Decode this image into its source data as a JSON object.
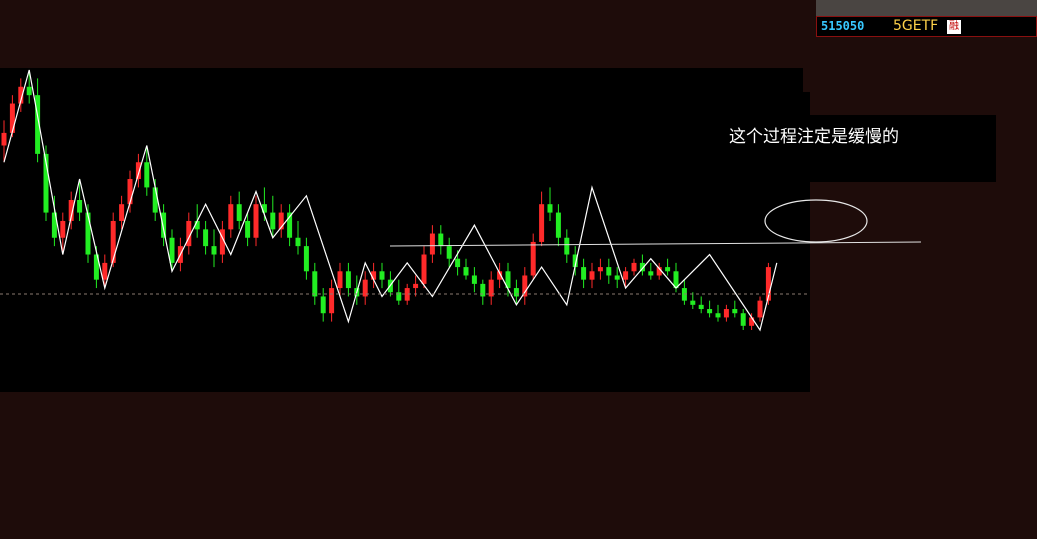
{
  "ticker": {
    "code": "515050",
    "name": "5GETF",
    "badge": "融"
  },
  "annotation": {
    "text": "这个过程注定是缓慢的"
  },
  "colors": {
    "background": "#1e0c0a",
    "plot_background": "#000000",
    "up": "#ff2a2a",
    "down": "#22ee22",
    "line": "#ffffff",
    "ticker_code": "#38c8ff",
    "ticker_name": "#ffd24a"
  },
  "chart_data": {
    "type": "candlestick",
    "title": "",
    "xlabel": "",
    "ylabel": "",
    "grid": false,
    "ylim": [
      0,
      100
    ],
    "reference_price": 41,
    "candles": [
      {
        "o": 74,
        "h": 80,
        "l": 70,
        "c": 77
      },
      {
        "o": 77,
        "h": 86,
        "l": 76,
        "c": 84
      },
      {
        "o": 84,
        "h": 90,
        "l": 82,
        "c": 88
      },
      {
        "o": 88,
        "h": 92,
        "l": 84,
        "c": 86
      },
      {
        "o": 86,
        "h": 90,
        "l": 70,
        "c": 72
      },
      {
        "o": 72,
        "h": 74,
        "l": 56,
        "c": 58
      },
      {
        "o": 58,
        "h": 62,
        "l": 50,
        "c": 52
      },
      {
        "o": 52,
        "h": 58,
        "l": 48,
        "c": 56
      },
      {
        "o": 56,
        "h": 63,
        "l": 54,
        "c": 61
      },
      {
        "o": 61,
        "h": 66,
        "l": 56,
        "c": 58
      },
      {
        "o": 58,
        "h": 60,
        "l": 46,
        "c": 48
      },
      {
        "o": 48,
        "h": 50,
        "l": 40,
        "c": 42
      },
      {
        "o": 42,
        "h": 48,
        "l": 40,
        "c": 46
      },
      {
        "o": 46,
        "h": 58,
        "l": 45,
        "c": 56
      },
      {
        "o": 56,
        "h": 62,
        "l": 54,
        "c": 60
      },
      {
        "o": 60,
        "h": 68,
        "l": 58,
        "c": 66
      },
      {
        "o": 66,
        "h": 72,
        "l": 64,
        "c": 70
      },
      {
        "o": 70,
        "h": 74,
        "l": 62,
        "c": 64
      },
      {
        "o": 64,
        "h": 66,
        "l": 56,
        "c": 58
      },
      {
        "o": 58,
        "h": 60,
        "l": 50,
        "c": 52
      },
      {
        "o": 52,
        "h": 54,
        "l": 44,
        "c": 46
      },
      {
        "o": 46,
        "h": 52,
        "l": 44,
        "c": 50
      },
      {
        "o": 50,
        "h": 58,
        "l": 48,
        "c": 56
      },
      {
        "o": 56,
        "h": 60,
        "l": 52,
        "c": 54
      },
      {
        "o": 54,
        "h": 56,
        "l": 48,
        "c": 50
      },
      {
        "o": 50,
        "h": 54,
        "l": 45,
        "c": 48
      },
      {
        "o": 48,
        "h": 56,
        "l": 46,
        "c": 54
      },
      {
        "o": 54,
        "h": 62,
        "l": 52,
        "c": 60
      },
      {
        "o": 60,
        "h": 63,
        "l": 54,
        "c": 56
      },
      {
        "o": 56,
        "h": 58,
        "l": 50,
        "c": 52
      },
      {
        "o": 52,
        "h": 62,
        "l": 50,
        "c": 60
      },
      {
        "o": 60,
        "h": 64,
        "l": 56,
        "c": 58
      },
      {
        "o": 58,
        "h": 62,
        "l": 52,
        "c": 54
      },
      {
        "o": 54,
        "h": 60,
        "l": 52,
        "c": 58
      },
      {
        "o": 58,
        "h": 60,
        "l": 50,
        "c": 52
      },
      {
        "o": 52,
        "h": 56,
        "l": 48,
        "c": 50
      },
      {
        "o": 50,
        "h": 52,
        "l": 42,
        "c": 44
      },
      {
        "o": 44,
        "h": 46,
        "l": 36,
        "c": 38
      },
      {
        "o": 38,
        "h": 40,
        "l": 32,
        "c": 34
      },
      {
        "o": 34,
        "h": 42,
        "l": 32,
        "c": 40
      },
      {
        "o": 40,
        "h": 46,
        "l": 38,
        "c": 44
      },
      {
        "o": 44,
        "h": 46,
        "l": 38,
        "c": 40
      },
      {
        "o": 40,
        "h": 43,
        "l": 36,
        "c": 38
      },
      {
        "o": 38,
        "h": 44,
        "l": 36,
        "c": 42
      },
      {
        "o": 42,
        "h": 46,
        "l": 40,
        "c": 44
      },
      {
        "o": 44,
        "h": 46,
        "l": 40,
        "c": 42
      },
      {
        "o": 42,
        "h": 44,
        "l": 38,
        "c": 39
      },
      {
        "o": 39,
        "h": 42,
        "l": 36,
        "c": 37
      },
      {
        "o": 37,
        "h": 41,
        "l": 36,
        "c": 40
      },
      {
        "o": 40,
        "h": 43,
        "l": 38,
        "c": 41
      },
      {
        "o": 41,
        "h": 50,
        "l": 40,
        "c": 48
      },
      {
        "o": 48,
        "h": 55,
        "l": 46,
        "c": 53
      },
      {
        "o": 53,
        "h": 55,
        "l": 48,
        "c": 50
      },
      {
        "o": 50,
        "h": 52,
        "l": 45,
        "c": 47
      },
      {
        "o": 47,
        "h": 49,
        "l": 43,
        "c": 45
      },
      {
        "o": 45,
        "h": 47,
        "l": 42,
        "c": 43
      },
      {
        "o": 43,
        "h": 45,
        "l": 39,
        "c": 41
      },
      {
        "o": 41,
        "h": 42,
        "l": 36,
        "c": 38
      },
      {
        "o": 38,
        "h": 44,
        "l": 36,
        "c": 42
      },
      {
        "o": 42,
        "h": 46,
        "l": 40,
        "c": 44
      },
      {
        "o": 44,
        "h": 46,
        "l": 38,
        "c": 40
      },
      {
        "o": 40,
        "h": 42,
        "l": 36,
        "c": 38
      },
      {
        "o": 38,
        "h": 45,
        "l": 36,
        "c": 43
      },
      {
        "o": 43,
        "h": 53,
        "l": 42,
        "c": 51
      },
      {
        "o": 51,
        "h": 63,
        "l": 50,
        "c": 60
      },
      {
        "o": 60,
        "h": 64,
        "l": 56,
        "c": 58
      },
      {
        "o": 58,
        "h": 60,
        "l": 50,
        "c": 52
      },
      {
        "o": 52,
        "h": 54,
        "l": 46,
        "c": 48
      },
      {
        "o": 48,
        "h": 50,
        "l": 43,
        "c": 45
      },
      {
        "o": 45,
        "h": 47,
        "l": 40,
        "c": 42
      },
      {
        "o": 42,
        "h": 46,
        "l": 40,
        "c": 44
      },
      {
        "o": 44,
        "h": 47,
        "l": 42,
        "c": 45
      },
      {
        "o": 45,
        "h": 47,
        "l": 41,
        "c": 43
      },
      {
        "o": 43,
        "h": 45,
        "l": 40,
        "c": 42
      },
      {
        "o": 42,
        "h": 45,
        "l": 40,
        "c": 44
      },
      {
        "o": 44,
        "h": 47,
        "l": 43,
        "c": 46
      },
      {
        "o": 46,
        "h": 48,
        "l": 43,
        "c": 44
      },
      {
        "o": 44,
        "h": 46,
        "l": 42,
        "c": 43
      },
      {
        "o": 43,
        "h": 46,
        "l": 42,
        "c": 45
      },
      {
        "o": 45,
        "h": 47,
        "l": 43,
        "c": 44
      },
      {
        "o": 44,
        "h": 46,
        "l": 39,
        "c": 40
      },
      {
        "o": 40,
        "h": 42,
        "l": 36,
        "c": 37
      },
      {
        "o": 37,
        "h": 39,
        "l": 35,
        "c": 36
      },
      {
        "o": 36,
        "h": 38,
        "l": 34,
        "c": 35
      },
      {
        "o": 35,
        "h": 37,
        "l": 33,
        "c": 34
      },
      {
        "o": 34,
        "h": 36,
        "l": 32,
        "c": 33
      },
      {
        "o": 33,
        "h": 36,
        "l": 32,
        "c": 35
      },
      {
        "o": 35,
        "h": 37,
        "l": 33,
        "c": 34
      },
      {
        "o": 34,
        "h": 35,
        "l": 30,
        "c": 31
      },
      {
        "o": 31,
        "h": 34,
        "l": 30,
        "c": 33
      },
      {
        "o": 33,
        "h": 38,
        "l": 32,
        "c": 37
      },
      {
        "o": 37,
        "h": 46,
        "l": 36,
        "c": 45
      }
    ],
    "zigzag": [
      {
        "i": 0,
        "v": 70
      },
      {
        "i": 3,
        "v": 92
      },
      {
        "i": 7,
        "v": 48
      },
      {
        "i": 9,
        "v": 66
      },
      {
        "i": 12,
        "v": 40
      },
      {
        "i": 17,
        "v": 74
      },
      {
        "i": 20,
        "v": 44
      },
      {
        "i": 24,
        "v": 60
      },
      {
        "i": 27,
        "v": 48
      },
      {
        "i": 30,
        "v": 63
      },
      {
        "i": 32,
        "v": 52
      },
      {
        "i": 36,
        "v": 62
      },
      {
        "i": 41,
        "v": 32
      },
      {
        "i": 43,
        "v": 46
      },
      {
        "i": 45,
        "v": 38
      },
      {
        "i": 48,
        "v": 46
      },
      {
        "i": 51,
        "v": 38
      },
      {
        "i": 56,
        "v": 55
      },
      {
        "i": 61,
        "v": 36
      },
      {
        "i": 64,
        "v": 45
      },
      {
        "i": 67,
        "v": 36
      },
      {
        "i": 70,
        "v": 64
      },
      {
        "i": 74,
        "v": 40
      },
      {
        "i": 77,
        "v": 47
      },
      {
        "i": 80,
        "v": 40
      },
      {
        "i": 84,
        "v": 48
      },
      {
        "i": 90,
        "v": 30
      },
      {
        "i": 92,
        "v": 46
      }
    ],
    "horizontal_line_level": 53
  }
}
